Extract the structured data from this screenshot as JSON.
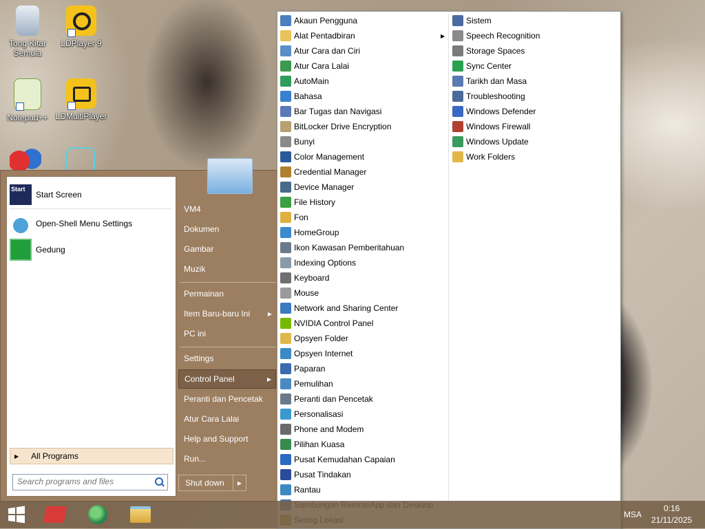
{
  "desktop": {
    "icons": [
      {
        "label_line1": "Tong Kitar",
        "label_line2": "Semula",
        "icon": "recycle-bin-icon"
      },
      {
        "label_line1": "LDPlayer 9",
        "label_line2": "",
        "icon": "ldplayer-icon"
      },
      {
        "label_line1": "Notepad++",
        "label_line2": "",
        "icon": "notepad-plus-plus-icon"
      },
      {
        "label_line1": "LDMultiPlayer",
        "label_line2": "",
        "icon": "ldmultiplayer-icon"
      }
    ]
  },
  "start_menu": {
    "programs": [
      {
        "label": "Start Screen",
        "icon": "start-screen-icon",
        "icon_text": "Start"
      },
      {
        "label": "Open-Shell Menu Settings",
        "icon": "open-shell-icon"
      },
      {
        "label": "Gedung",
        "icon": "store-icon"
      }
    ],
    "all_programs_label": "All Programs",
    "search_placeholder": "Search programs and files",
    "right_items": [
      {
        "label": "VM4",
        "submenu": false
      },
      {
        "label": "Dokumen",
        "submenu": false
      },
      {
        "label": "Gambar",
        "submenu": false
      },
      {
        "label": "Muzik",
        "submenu": false
      },
      {
        "label": "Permainan",
        "submenu": false
      },
      {
        "label": "Item Baru-baru Ini",
        "submenu": true
      },
      {
        "label": "PC ini",
        "submenu": false
      },
      {
        "label": "Settings",
        "submenu": false
      },
      {
        "label": "Control Panel",
        "submenu": true,
        "highlighted": true
      },
      {
        "label": "Peranti dan Pencetak",
        "submenu": false
      },
      {
        "label": "Atur Cara Lalai",
        "submenu": false
      },
      {
        "label": "Help and Support",
        "submenu": false
      },
      {
        "label": "Run...",
        "submenu": false
      }
    ],
    "shutdown_label": "Shut down"
  },
  "control_panel": {
    "column1": [
      {
        "label": "Akaun Pengguna",
        "color": "#4a7fc0"
      },
      {
        "label": "Alat Pentadbiran",
        "color": "#e8c25a",
        "submenu": true
      },
      {
        "label": "Atur Cara dan Ciri",
        "color": "#5a8fc8"
      },
      {
        "label": "Atur Cara Lalai",
        "color": "#3c9a50"
      },
      {
        "label": "AutoMain",
        "color": "#2f9e5a"
      },
      {
        "label": "Bahasa",
        "color": "#3a7fd0"
      },
      {
        "label": "Bar Tugas dan Navigasi",
        "color": "#5b78b8"
      },
      {
        "label": "BitLocker Drive Encryption",
        "color": "#b8a070"
      },
      {
        "label": "Bunyi",
        "color": "#8a8a8a"
      },
      {
        "label": "Color Management",
        "color": "#2a5a9a"
      },
      {
        "label": "Credential Manager",
        "color": "#b08030"
      },
      {
        "label": "Device Manager",
        "color": "#4a6a8a"
      },
      {
        "label": "File History",
        "color": "#3aa040"
      },
      {
        "label": "Fon",
        "color": "#e0b040"
      },
      {
        "label": "HomeGroup",
        "color": "#3a8ad0"
      },
      {
        "label": "Ikon Kawasan Pemberitahuan",
        "color": "#6a7a8a"
      },
      {
        "label": "Indexing Options",
        "color": "#8a9aa8"
      },
      {
        "label": "Keyboard",
        "color": "#707070"
      },
      {
        "label": "Mouse",
        "color": "#9a9a9a"
      },
      {
        "label": "Network and Sharing Center",
        "color": "#3a7ac0"
      },
      {
        "label": "NVIDIA Control Panel",
        "color": "#76b900"
      },
      {
        "label": "Opsyen Folder",
        "color": "#e0b84a"
      },
      {
        "label": "Opsyen Internet",
        "color": "#3a8ac8"
      },
      {
        "label": "Paparan",
        "color": "#3a6ab0"
      },
      {
        "label": "Pemulihan",
        "color": "#4a8ac0"
      },
      {
        "label": "Peranti dan Pencetak",
        "color": "#6a7a8a"
      },
      {
        "label": "Personalisasi",
        "color": "#3a9ad0"
      },
      {
        "label": "Phone and Modem",
        "color": "#6a6a6a"
      },
      {
        "label": "Pilihan Kuasa",
        "color": "#3a8a50"
      },
      {
        "label": "Pusat Kemudahan Capaian",
        "color": "#2a6ac0"
      },
      {
        "label": "Pusat Tindakan",
        "color": "#2a4a9a"
      },
      {
        "label": "Rantau",
        "color": "#3a8ac0"
      },
      {
        "label": "Sambungan RemoteApp dan Desktop",
        "color": "#4a7ab0"
      },
      {
        "label": "Seting Lokasi",
        "color": "#a0a040"
      }
    ],
    "column2": [
      {
        "label": "Sistem",
        "color": "#4a6aa0"
      },
      {
        "label": "Speech Recognition",
        "color": "#8a8a8a"
      },
      {
        "label": "Storage Spaces",
        "color": "#7a7a7a"
      },
      {
        "label": "Sync Center",
        "color": "#2aa050"
      },
      {
        "label": "Tarikh dan Masa",
        "color": "#5a7ab0"
      },
      {
        "label": "Troubleshooting",
        "color": "#4a6a9a"
      },
      {
        "label": "Windows Defender",
        "color": "#3a6ac0"
      },
      {
        "label": "Windows Firewall",
        "color": "#b04030"
      },
      {
        "label": "Windows Update",
        "color": "#3a9a60"
      },
      {
        "label": "Work Folders",
        "color": "#e0b84a"
      }
    ]
  },
  "taskbar": {
    "items": [
      "start-button",
      "app-red-icon",
      "browser-icon",
      "file-explorer-icon"
    ],
    "tray": {
      "language": "MSA",
      "time": "0:16",
      "date": "21/11/2025"
    }
  }
}
